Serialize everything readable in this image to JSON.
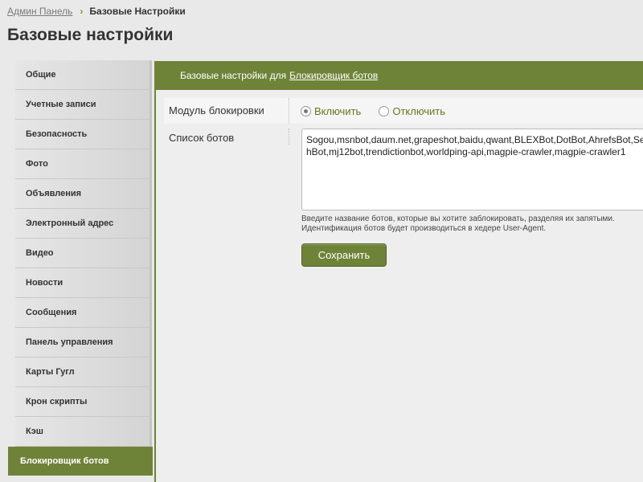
{
  "breadcrumb": {
    "home": "Админ Панель",
    "current": "Базовые Настройки"
  },
  "page_title": "Базовые настройки",
  "sidebar": {
    "items": [
      {
        "label": "Общие"
      },
      {
        "label": "Учетные записи"
      },
      {
        "label": "Безопасность"
      },
      {
        "label": "Фото"
      },
      {
        "label": "Объявления"
      },
      {
        "label": "Электронный адрес"
      },
      {
        "label": "Видео"
      },
      {
        "label": "Новости"
      },
      {
        "label": "Сообщения"
      },
      {
        "label": "Панель управления"
      },
      {
        "label": "Карты Гугл"
      },
      {
        "label": "Крон скрипты"
      },
      {
        "label": "Кэш"
      },
      {
        "label": "Блокировщик ботов",
        "active": true
      }
    ]
  },
  "header": {
    "prefix": "Базовые настройки для",
    "link": "Блокировщик ботов"
  },
  "form": {
    "module_label": "Модуль блокировки",
    "enable_label": "Включить",
    "disable_label": "Отключить",
    "selected": "enable",
    "bots_label": "Список ботов",
    "bots_value": "Sogou,msnbot,daum.net,grapeshot,baidu,qwant,BLEXBot,DotBot,AhrefsBot,Se\nhBot,mj12bot,trendictionbot,worldping-api,magpie-crawler,magpie-crawler1",
    "hint_line1": "Введите название ботов, которые вы хотите заблокировать, разделяя их запятыми.",
    "hint_line2": "Идентификация ботов будет производиться в хедере User-Agent.",
    "save_label": "Сохранить"
  },
  "colors": {
    "accent": "#6f8338",
    "accent_text": "#5f7a1c"
  }
}
